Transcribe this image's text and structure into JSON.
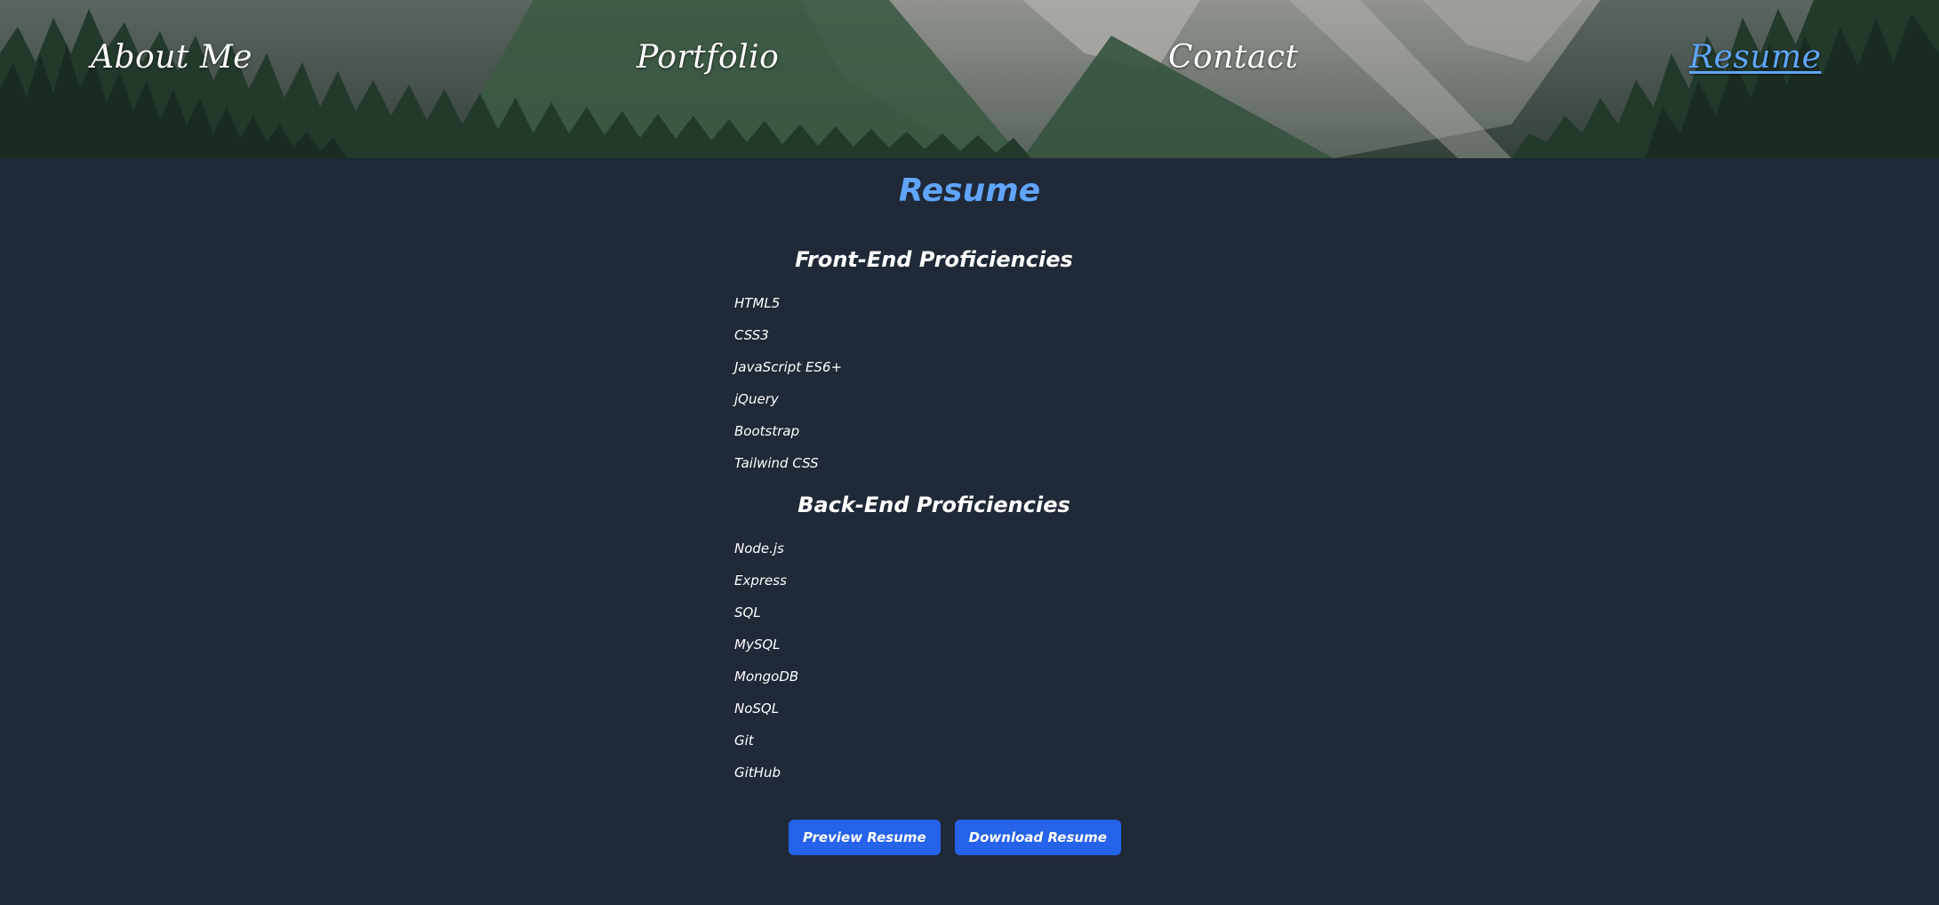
{
  "nav": {
    "items": [
      {
        "label": "About Me",
        "active": false
      },
      {
        "label": "Portfolio",
        "active": false
      },
      {
        "label": "Contact",
        "active": false
      },
      {
        "label": "Resume",
        "active": true
      }
    ]
  },
  "resume": {
    "title": "Resume",
    "front_end": {
      "heading": "Front-End Proficiencies",
      "items": [
        "HTML5",
        "CSS3",
        "JavaScript ES6+",
        "jQuery",
        "Bootstrap",
        "Tailwind CSS"
      ]
    },
    "back_end": {
      "heading": "Back-End Proficiencies",
      "items": [
        "Node.js",
        "Express",
        "SQL",
        "MySQL",
        "MongoDB",
        "NoSQL",
        "Git",
        "GitHub"
      ]
    },
    "buttons": {
      "preview": "Preview Resume",
      "download": "Download Resume"
    }
  },
  "colors": {
    "background": "#1f2937",
    "accent": "#60a5fa",
    "button": "#2563eb",
    "text": "#ffffff"
  }
}
